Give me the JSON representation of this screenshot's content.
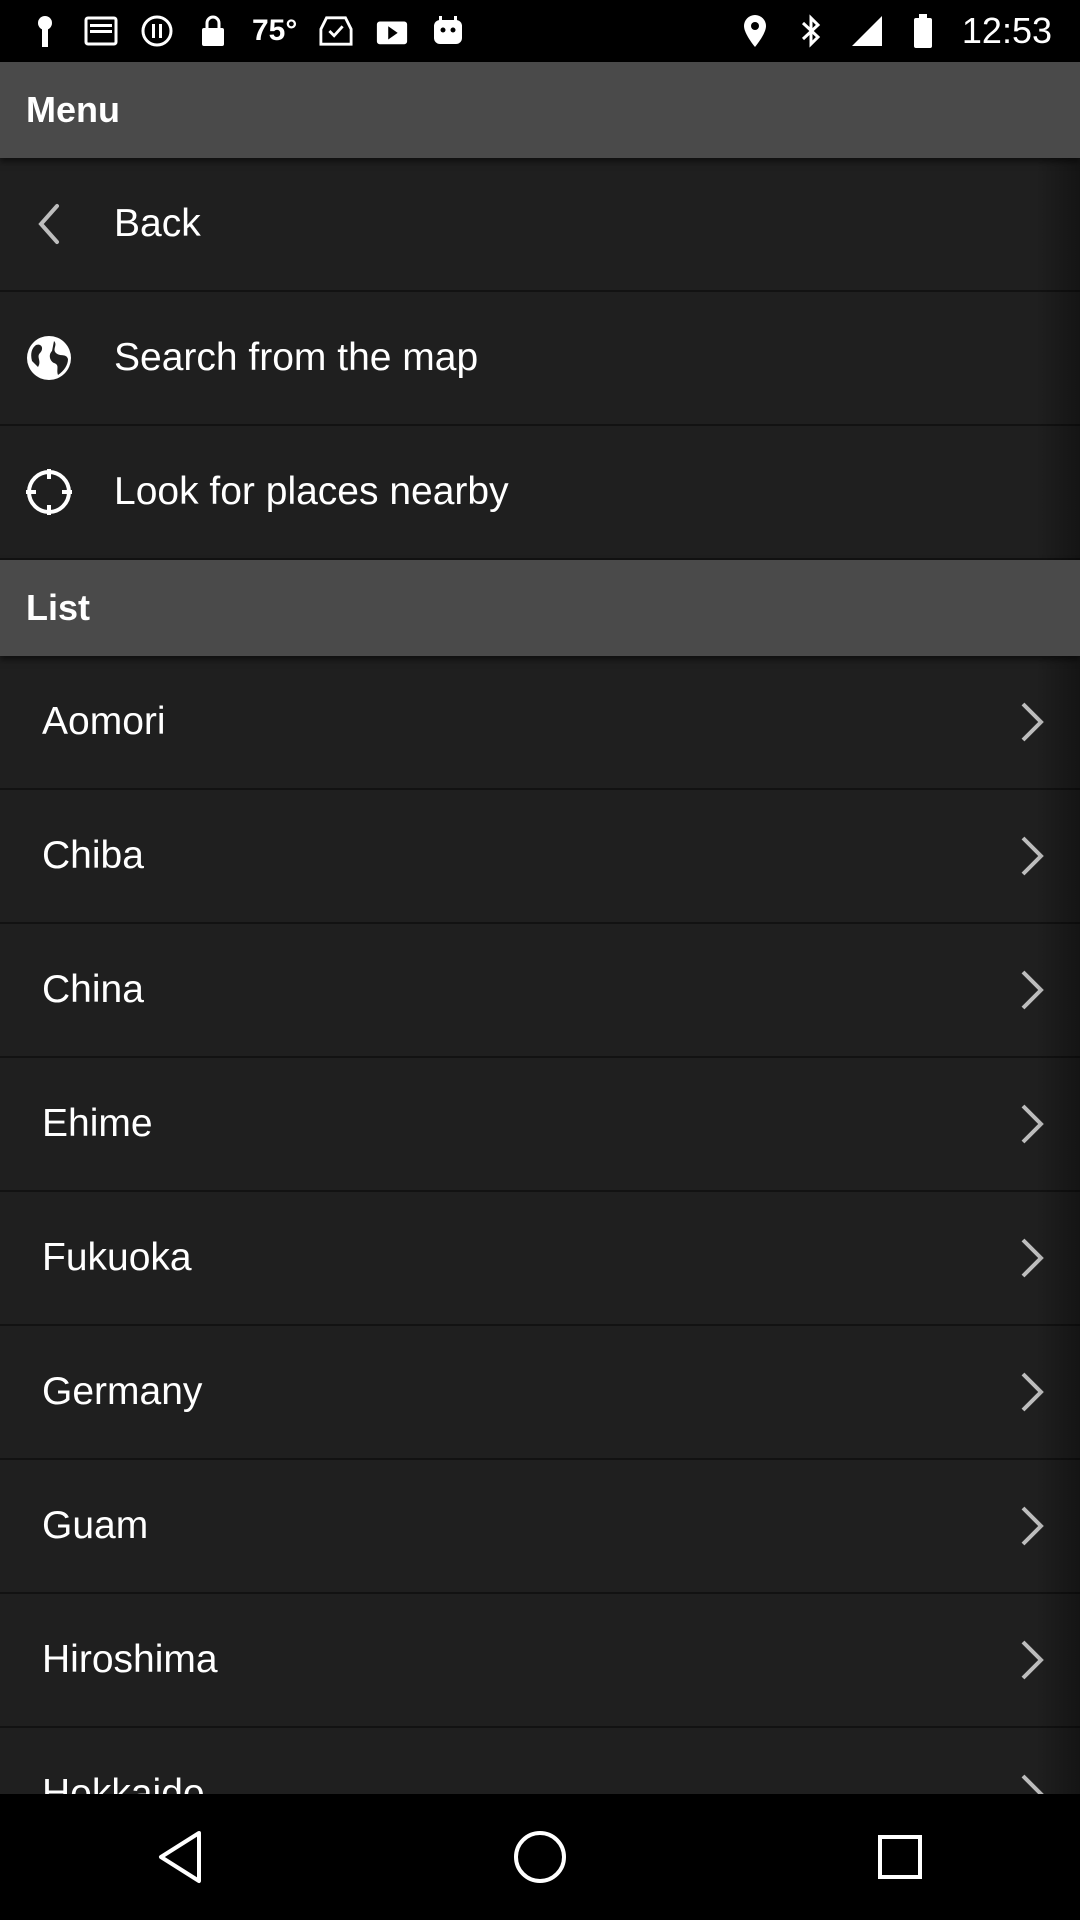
{
  "status_bar": {
    "temperature": "75°",
    "time": "12:53",
    "left_icons": [
      "notification-icon",
      "inbox-icon",
      "alert-icon",
      "lock-icon",
      "inbox-check-icon",
      "play-store-icon",
      "robot-icon"
    ],
    "right_icons": [
      "location-icon",
      "bluetooth-icon",
      "signal-icon",
      "battery-icon"
    ]
  },
  "menu": {
    "header": "Menu",
    "items": [
      {
        "label": "Back",
        "icon": "back-arrow-icon"
      },
      {
        "label": "Search from the map",
        "icon": "globe-icon"
      },
      {
        "label": "Look for places nearby",
        "icon": "crosshair-icon"
      }
    ]
  },
  "list": {
    "header": "List",
    "items": [
      {
        "label": "Aomori"
      },
      {
        "label": "Chiba"
      },
      {
        "label": "China"
      },
      {
        "label": "Ehime"
      },
      {
        "label": "Fukuoka"
      },
      {
        "label": "Germany"
      },
      {
        "label": "Guam"
      },
      {
        "label": "Hiroshima"
      },
      {
        "label": "Hokkaido"
      }
    ]
  },
  "nav_bar": {
    "buttons": [
      "back-nav-icon",
      "home-nav-icon",
      "recents-nav-icon"
    ]
  },
  "colors": {
    "header_bg": "#4a4a4a",
    "panel_bg": "#1f1f1f",
    "divider": "#121212",
    "text": "#ffffff"
  }
}
